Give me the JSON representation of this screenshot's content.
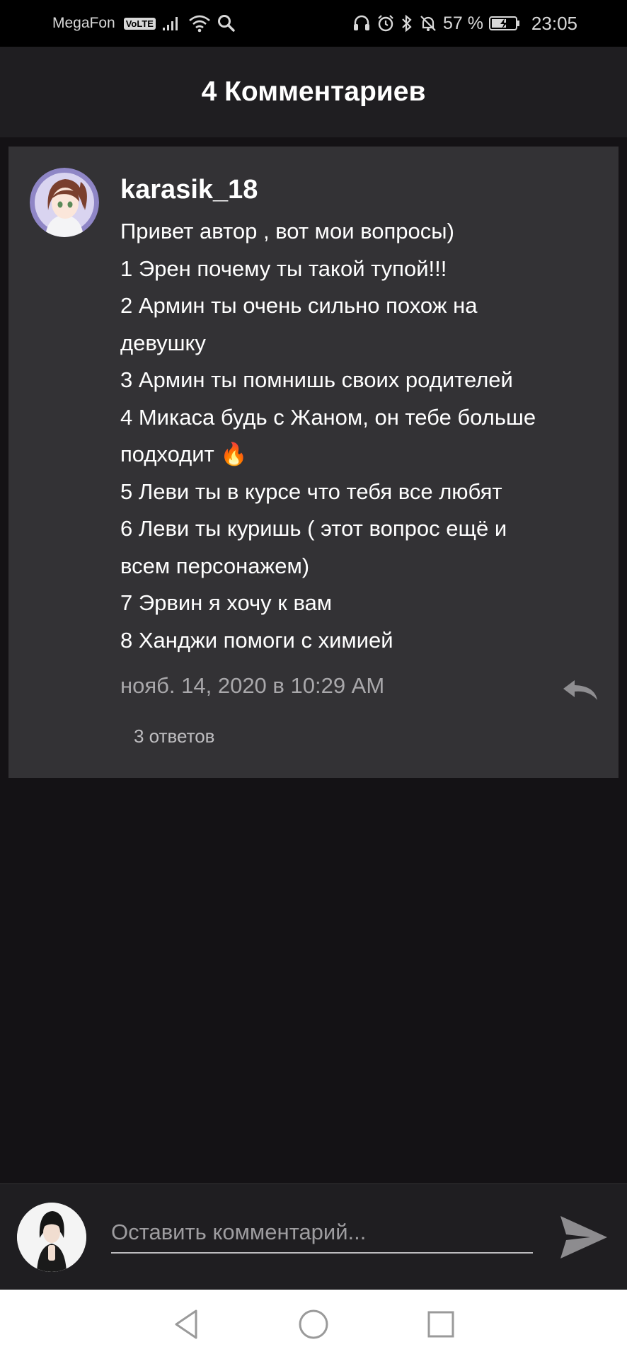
{
  "status_bar": {
    "carrier": "MegaFon",
    "volte": "VoLTE",
    "battery": "57 %",
    "time": "23:05"
  },
  "header": {
    "title": "4 Комментариев"
  },
  "comment": {
    "username": "karasik_18",
    "lines": [
      "Привет автор , вот мои вопросы)",
      "1 Эрен почему ты такой тупой!!!",
      "2 Армин ты очень сильно похож на",
      "девушку",
      "3 Армин ты помнишь своих родителей",
      "4 Микаса будь с  Жаном, он тебе больше",
      "подходит 🔥",
      "5 Леви ты в курсе что тебя все любят",
      "6 Леви ты куришь ( этот вопрос ещё и",
      "всем персонажем)",
      "7 Эрвин я хочу к вам",
      "8 Ханджи помоги с химией"
    ],
    "timestamp": "нояб. 14, 2020 в 10:29 AM",
    "replies": "3 ответов"
  },
  "input": {
    "placeholder": "Оставить комментарий..."
  },
  "icons": {
    "reply": "reply-icon",
    "send": "send-icon",
    "nav_back": "back-triangle-icon",
    "nav_home": "home-circle-icon",
    "nav_recents": "recents-square-icon"
  }
}
